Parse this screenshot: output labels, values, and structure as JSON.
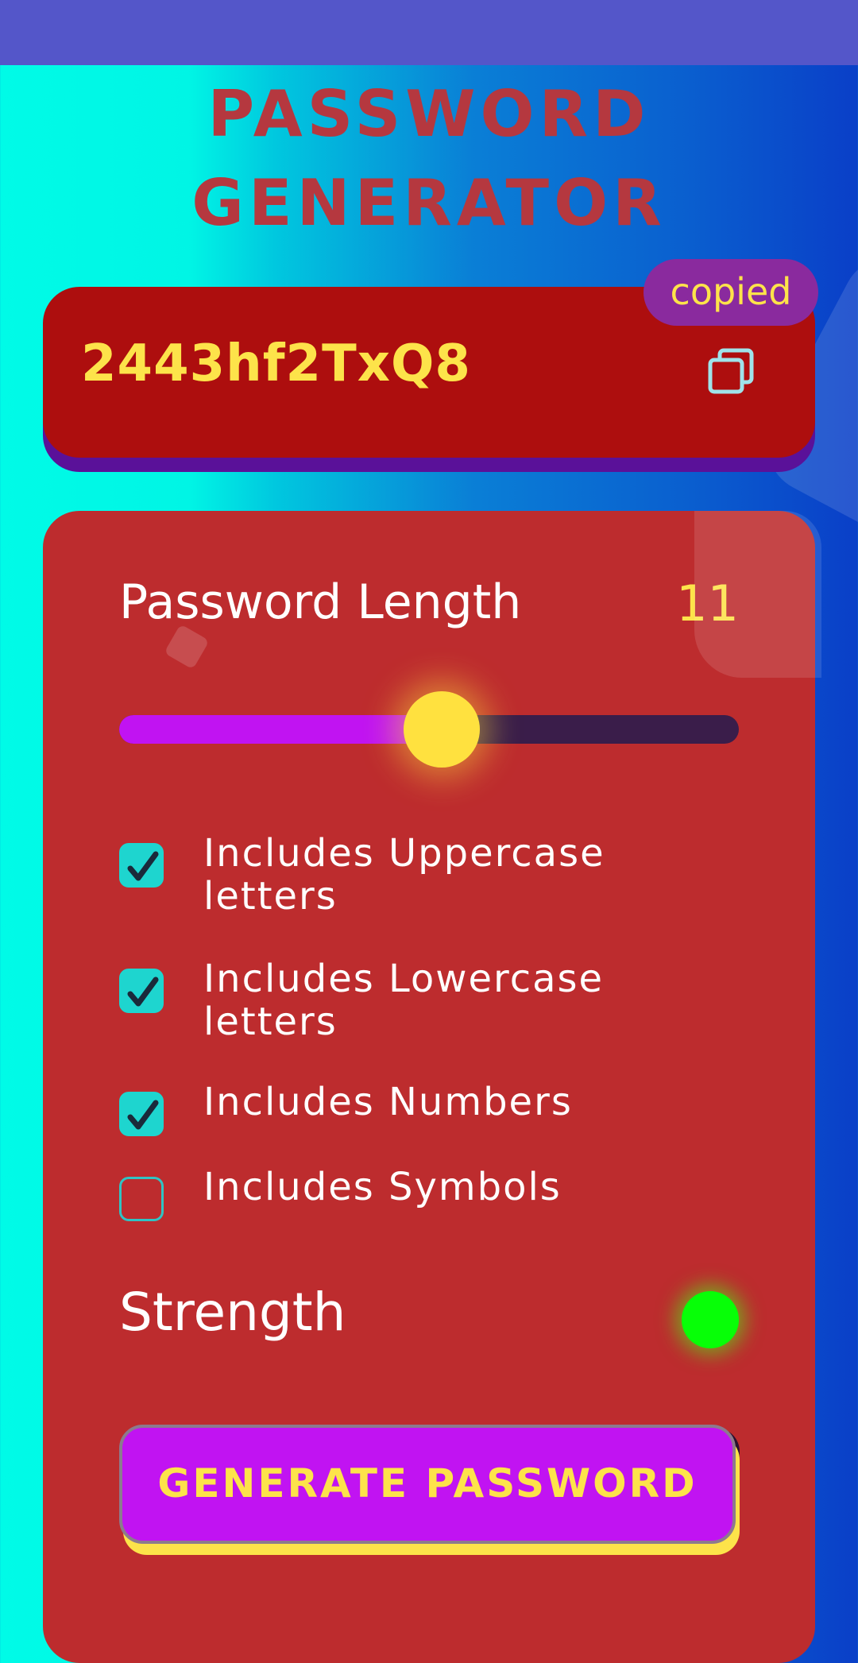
{
  "title": {
    "line1": "PASSWORD",
    "line2": "GENERATOR"
  },
  "password": {
    "value": "2443hf2TxQ8",
    "copied_label": "copied"
  },
  "settings": {
    "length_label": "Password Length",
    "length_value": "11",
    "slider_fraction": 0.52,
    "options": [
      {
        "label": "Includes Uppercase letters",
        "checked": true
      },
      {
        "label": "Includes Lowercase letters",
        "checked": true
      },
      {
        "label": "Includes Numbers",
        "checked": true
      },
      {
        "label": "Includes Symbols",
        "checked": false
      }
    ],
    "strength_label": "Strength",
    "strength_color": "#07ff07",
    "generate_label": "GENERATE PASSWORD"
  },
  "colors": {
    "title": "#b5383f",
    "accent_yellow": "#fde34a",
    "accent_purple": "#c113f2",
    "card_red": "#bd2c2e",
    "password_card": "#ad0e0e"
  },
  "icons": {
    "copy": "copy-icon",
    "check": "check-icon"
  }
}
